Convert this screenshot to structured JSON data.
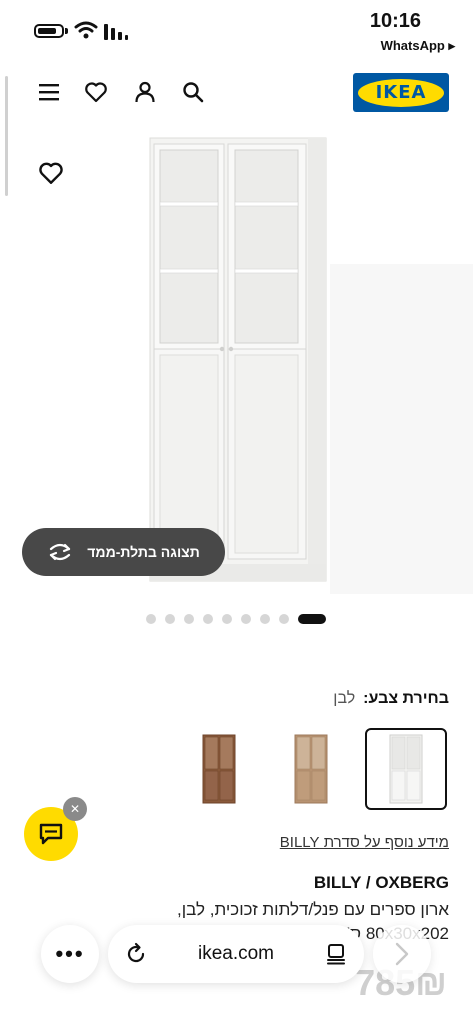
{
  "status_bar": {
    "time": "10:16",
    "back_app": "WhatsApp ▸"
  },
  "header": {
    "logo_text": "IKEA",
    "icons": [
      "menu-icon",
      "heart-icon",
      "user-icon",
      "search-icon"
    ]
  },
  "gallery": {
    "view_3d_label": "תצוגה בתלת-ממד",
    "dot_count": 9,
    "active_dot": 8
  },
  "color": {
    "label": "בחירת צבע:",
    "value": "לבן",
    "swatches": [
      "white",
      "oak",
      "walnut"
    ]
  },
  "series_link": "מידע נוסף על סדרת BILLY",
  "product": {
    "name": "BILLY / OXBERG",
    "description_line1": "ארון ספרים עם פנל/דלתות זכוכית, לבן,",
    "description_line2": "80x30x202 ס\"מ",
    "price": "785₪"
  },
  "browser": {
    "url": "ikea.com",
    "more_label": "•••"
  },
  "colors": {
    "ikea_blue": "#0058a3",
    "ikea_yellow": "#ffdb00",
    "pill_bg": "#484848"
  }
}
